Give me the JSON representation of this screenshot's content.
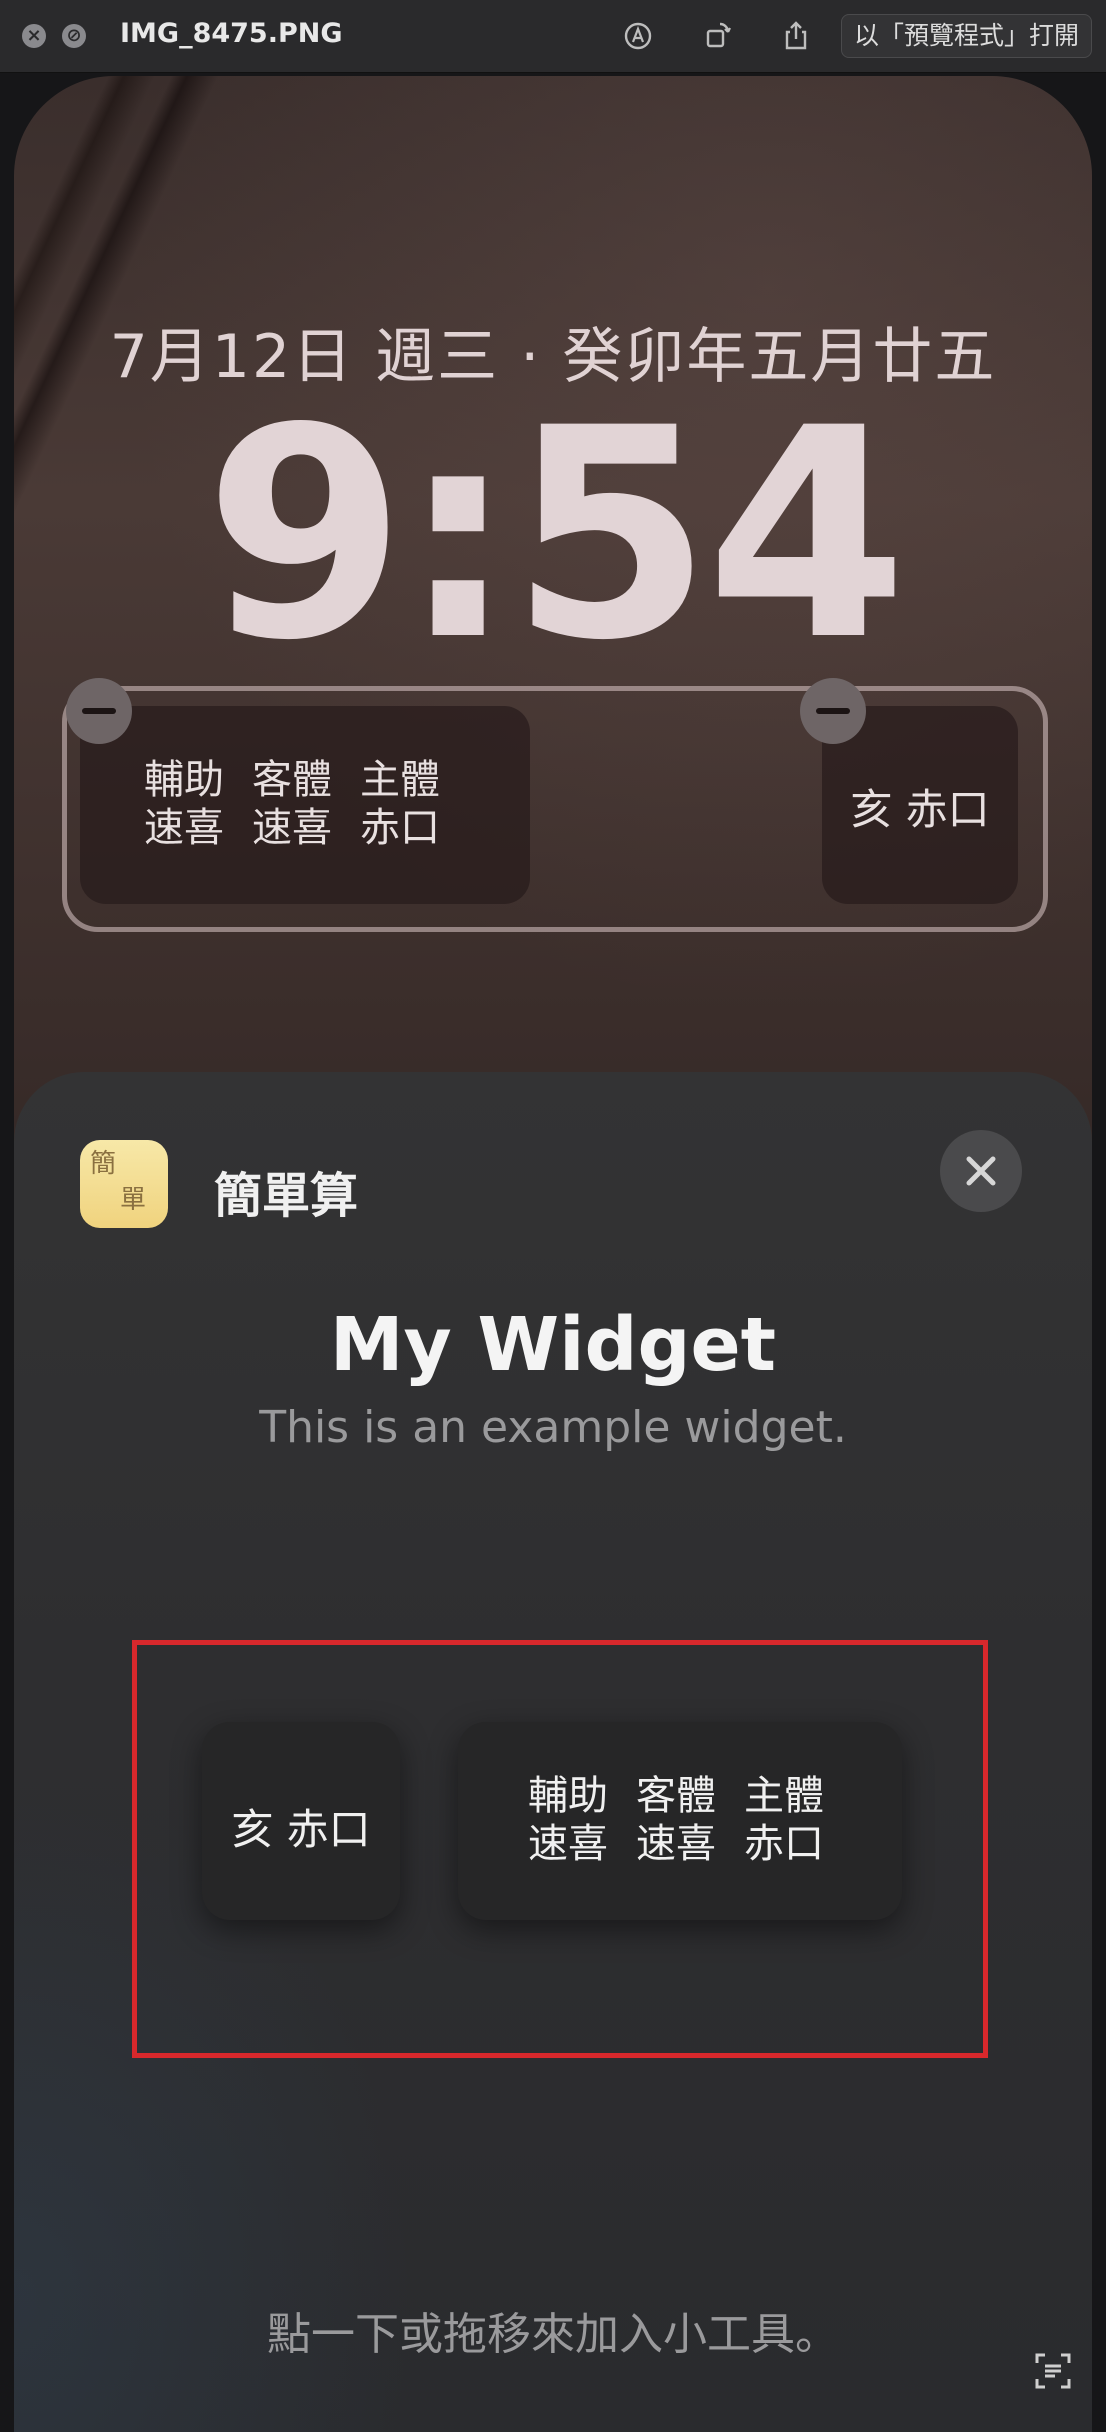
{
  "titlebar": {
    "filename": "IMG_8475.PNG",
    "open_with_label": "以「預覽程式」打開"
  },
  "lockscreen": {
    "date": "7月12日 週三 · 癸卯年五月廿五",
    "time": "9:54",
    "widget_rect": {
      "row1": [
        "輔助",
        "客體",
        "主體"
      ],
      "row2": [
        "速喜",
        "速喜",
        "赤口"
      ]
    },
    "widget_small": {
      "text": "亥  赤口"
    }
  },
  "sheet": {
    "app_name": "簡單算",
    "app_icon_glyphs": [
      "簡",
      "單"
    ],
    "title": "My Widget",
    "subtitle": "This is an example widget.",
    "preview_small": {
      "text": "亥  赤口"
    },
    "preview_rect": {
      "row1": [
        "輔助",
        "客體",
        "主體"
      ],
      "row2": [
        "速喜",
        "速喜",
        "赤口"
      ]
    },
    "hint": "點一下或拖移來加入小工具。"
  },
  "colors": {
    "preview_border": "#d8282c",
    "sheet_bg": "#2e2e30"
  }
}
